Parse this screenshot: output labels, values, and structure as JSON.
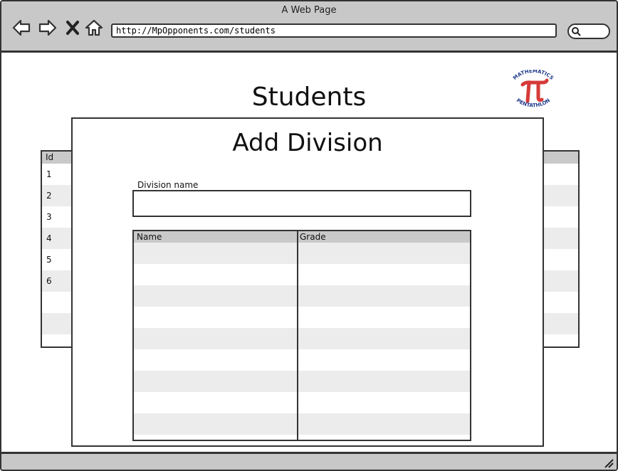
{
  "window": {
    "title": "A Web Page"
  },
  "browser": {
    "url": "http://MpOpponents.com/students",
    "nav_icons": [
      "back-arrow-icon",
      "forward-arrow-icon",
      "close-x-icon",
      "home-icon"
    ],
    "search_icon": "search-icon"
  },
  "page": {
    "title": "Students",
    "logo": {
      "icon": "pi-logo",
      "text_top": "MATHEMATICS",
      "text_bottom": "PENTATHLON",
      "color": "#d63a3a"
    }
  },
  "students_table": {
    "header": "Id",
    "rows": [
      "1",
      "2",
      "3",
      "4",
      "5",
      "6",
      "",
      "",
      ""
    ]
  },
  "dialog": {
    "title": "Add Division",
    "division_label": "Division name",
    "division_value": "",
    "grid": {
      "columns": [
        "Name",
        "Grade"
      ],
      "row_count": 9
    }
  },
  "colors": {
    "chrome": "#c8c8c8",
    "header": "#c9c9c9",
    "alt_row": "#ececec",
    "border": "#333333"
  }
}
